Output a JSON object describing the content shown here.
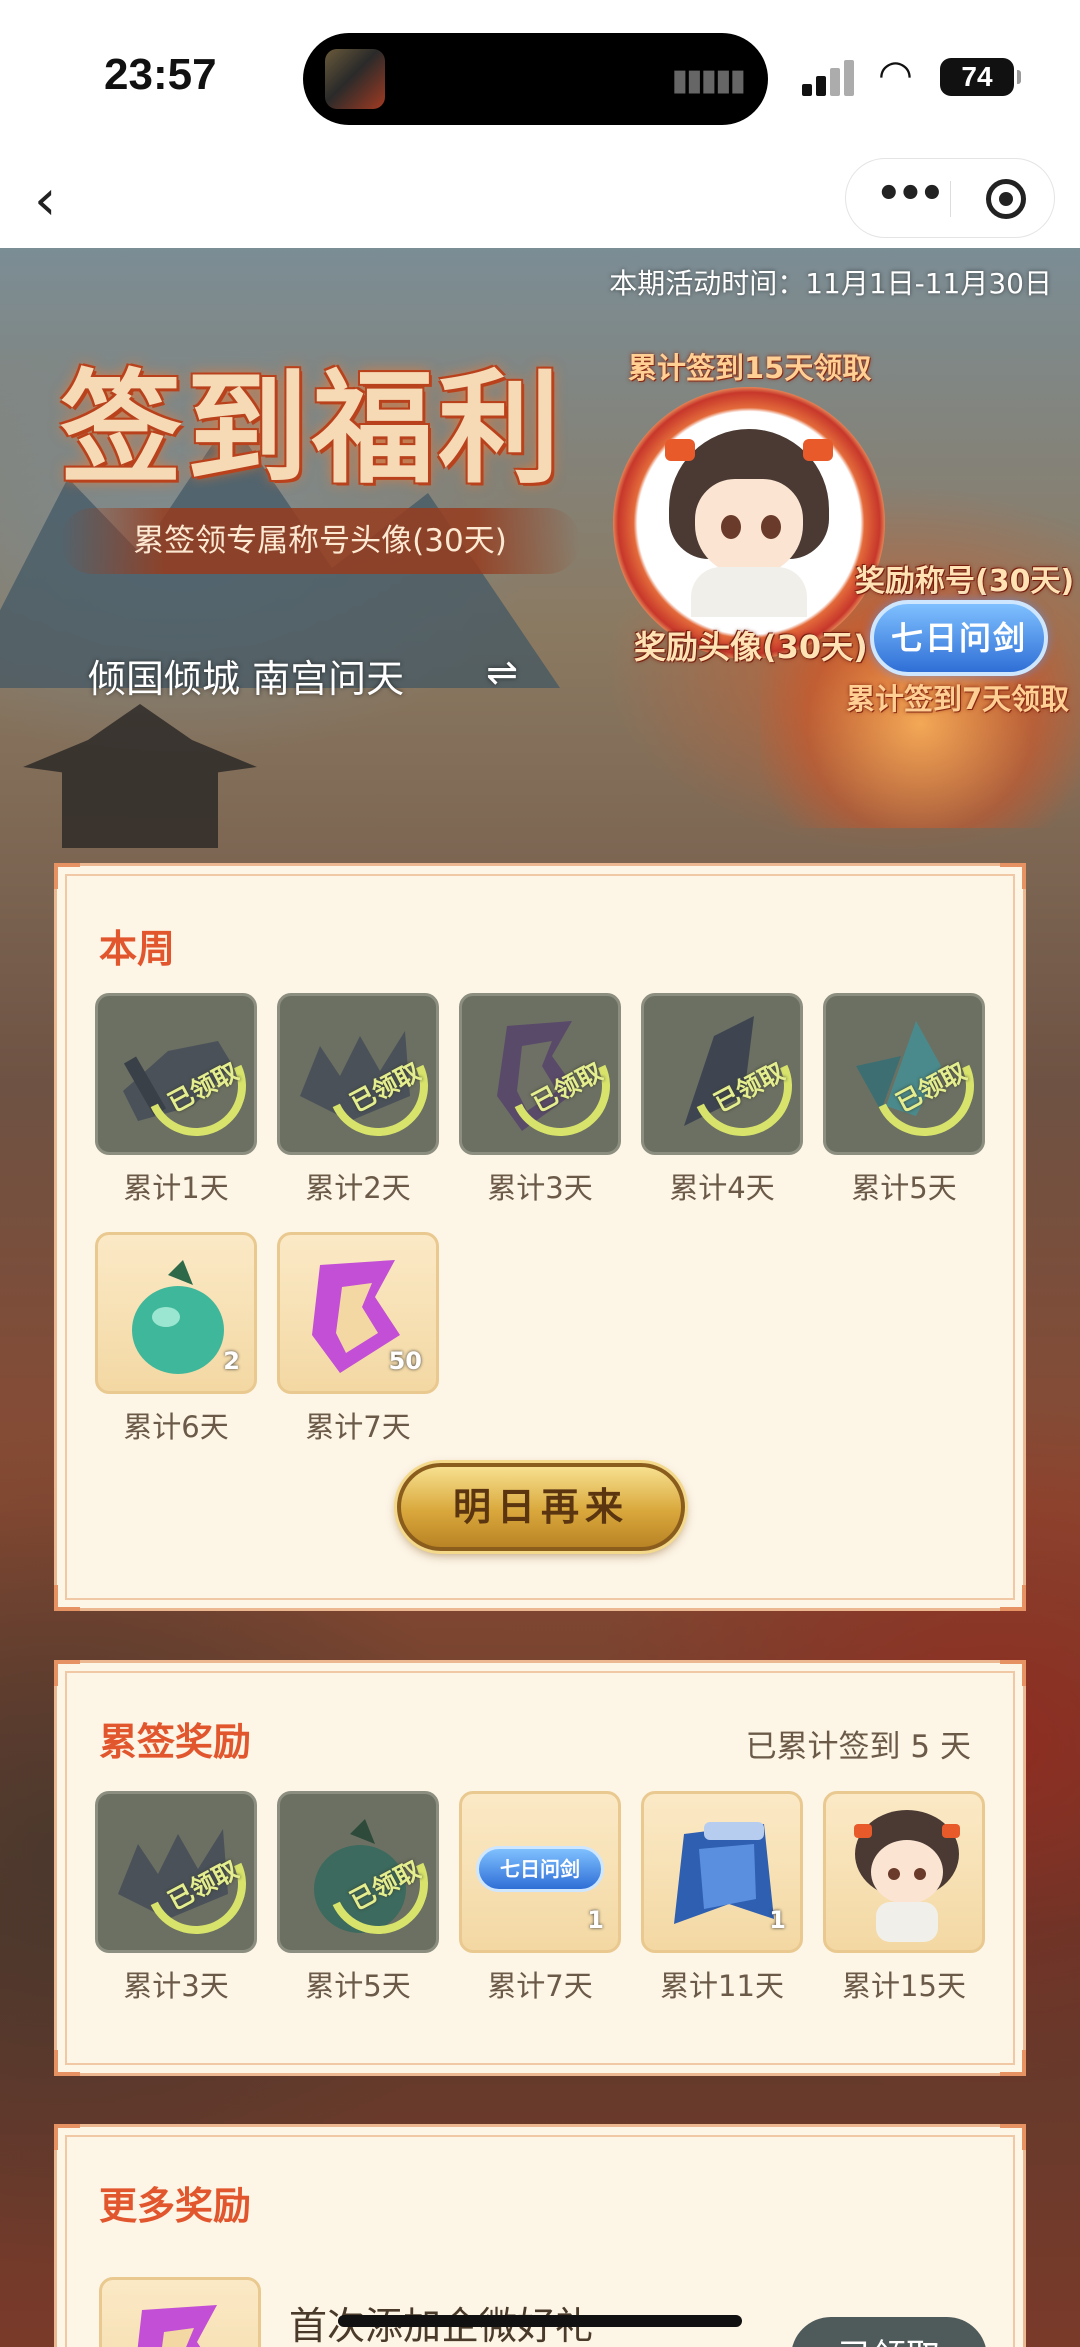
{
  "status_bar": {
    "time": "23:57",
    "battery": "74"
  },
  "nav": {
    "back_icon": "chevron-left-icon",
    "more_icon": "more-dots-icon",
    "close_icon": "target-icon"
  },
  "banner": {
    "period": "本期活动时间：11月1日-11月30日",
    "title": "签到福利",
    "subtitle": "累签领专属称号头像(30天)",
    "player": "倾国倾城 南宫问天",
    "swap_symbol": "⇌",
    "hint_15": "累计签到15天领取",
    "avatar_label": "奖励头像(30天)",
    "title_label": "奖励称号(30天)",
    "title_badge": "七日问剑",
    "hint_7": "累计签到7天领取"
  },
  "week": {
    "heading": "本周",
    "stamp": "已领取",
    "items": [
      {
        "label": "累计1天",
        "state": "claimed",
        "icon": "scroll-icon"
      },
      {
        "label": "累计2天",
        "state": "claimed",
        "icon": "crown-shard-icon"
      },
      {
        "label": "累计3天",
        "state": "claimed",
        "icon": "purple-gem-icon"
      },
      {
        "label": "累计4天",
        "state": "claimed",
        "icon": "dark-crystal-icon"
      },
      {
        "label": "累计5天",
        "state": "claimed",
        "icon": "jade-crystal-icon"
      },
      {
        "label": "累计6天",
        "state": "open",
        "icon": "jade-gourd-icon",
        "qty": "2"
      },
      {
        "label": "累计7天",
        "state": "open",
        "icon": "purple-gem-icon",
        "qty": "50"
      }
    ],
    "button": "明日再来"
  },
  "cumulative": {
    "heading": "累签奖励",
    "progress": "已累计签到 5 天",
    "stamp": "已领取",
    "items": [
      {
        "label": "累计3天",
        "state": "claimed",
        "icon": "crown-shard-icon"
      },
      {
        "label": "累计5天",
        "state": "claimed",
        "icon": "jade-gourd-icon"
      },
      {
        "label": "累计7天",
        "state": "open",
        "icon": "title-badge-icon",
        "badge": "七日问剑",
        "qty": "1"
      },
      {
        "label": "累计11天",
        "state": "open",
        "icon": "blue-cloak-icon",
        "qty": "1"
      },
      {
        "label": "累计15天",
        "state": "open",
        "icon": "avatar-portrait-icon"
      }
    ]
  },
  "more": {
    "heading": "更多奖励",
    "item_text": "首次添加企微好礼",
    "button": "已领取"
  }
}
